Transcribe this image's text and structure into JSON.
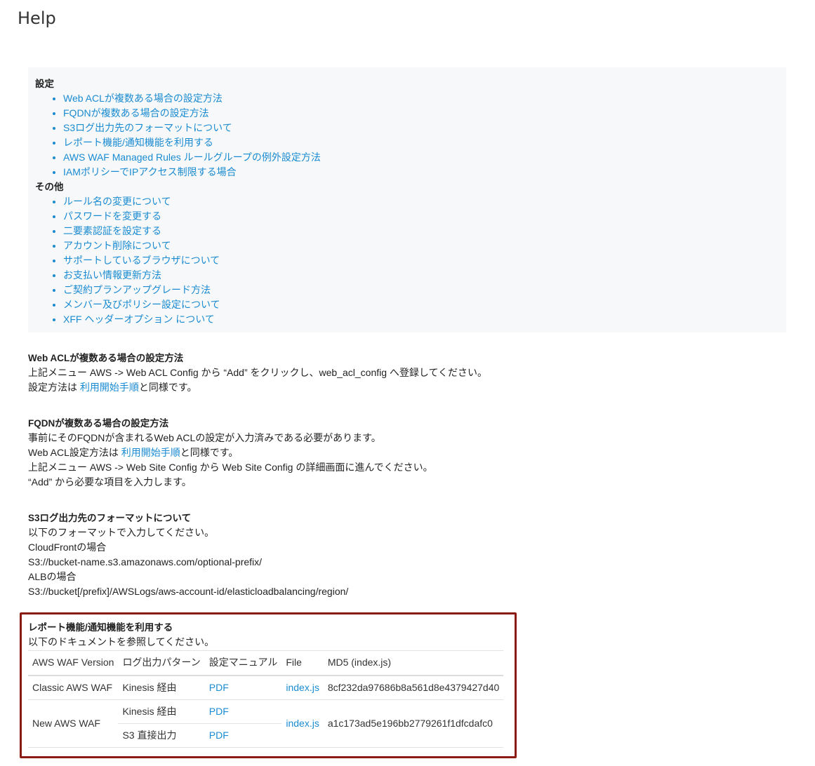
{
  "page": {
    "title": "Help"
  },
  "toc": {
    "settings_heading": "設定",
    "settings_items": [
      "Web ACLが複数ある場合の設定方法",
      "FQDNが複数ある場合の設定方法",
      "S3ログ出力先のフォーマットについて",
      "レポート機能/通知機能を利用する",
      "AWS WAF Managed Rules ルールグループの例外設定方法",
      "IAMポリシーでIPアクセス制限する場合"
    ],
    "other_heading": "その他",
    "other_items": [
      "ルール名の変更について",
      "パスワードを変更する",
      "二要素認証を設定する",
      "アカウント削除について",
      "サポートしているブラウザについて",
      "お支払い情報更新方法",
      "ご契約プランアップグレード方法",
      "メンバー及びポリシー設定について",
      "XFF ヘッダーオプション について"
    ]
  },
  "webacl": {
    "title": "Web ACLが複数ある場合の設定方法",
    "line1": "上記メニュー AWS -> Web ACL Config から “Add” をクリックし、web_acl_config へ登録してください。",
    "line2_pre": "設定方法は ",
    "line2_link": "利用開始手順",
    "line2_post": "と同様です。"
  },
  "fqdn": {
    "title": "FQDNが複数ある場合の設定方法",
    "line1": "事前にそのFQDNが含まれるWeb ACLの設定が入力済みである必要があります。",
    "line2_pre": "Web ACL設定方法は ",
    "line2_link": "利用開始手順",
    "line2_post": "と同様です。",
    "line3": "上記メニュー AWS -> Web Site Config から Web Site Config の詳細画面に進んでください。",
    "line4": "“Add” から必要な項目を入力します。"
  },
  "s3": {
    "title": "S3ログ出力先のフォーマットについて",
    "line1": "以下のフォーマットで入力してください。",
    "line2": "CloudFrontの場合",
    "line3": "S3://bucket-name.s3.amazonaws.com/optional-prefix/",
    "line4": "ALBの場合",
    "line5": "S3://bucket[/prefix]/AWSLogs/aws-account-id/elasticloadbalancing/region/"
  },
  "report": {
    "title": "レポート機能/通知機能を利用する",
    "intro": "以下のドキュメントを参照してください。",
    "headers": [
      "AWS WAF Version",
      "ログ出力パターン",
      "設定マニュアル",
      "File",
      "MD5 (index.js)"
    ],
    "rows": [
      {
        "version": "Classic AWS WAF",
        "pattern": "Kinesis 経由",
        "manual": "PDF",
        "file": "index.js",
        "md5": "8cf232da97686b8a561d8e4379427d40"
      },
      {
        "version": "New AWS WAF",
        "pattern": "Kinesis 経由",
        "manual": "PDF",
        "file": "index.js",
        "md5": "a1c173ad5e196bb2779261f1dfcdafc0"
      },
      {
        "pattern": "S3 直接出力",
        "manual": "PDF"
      }
    ]
  }
}
